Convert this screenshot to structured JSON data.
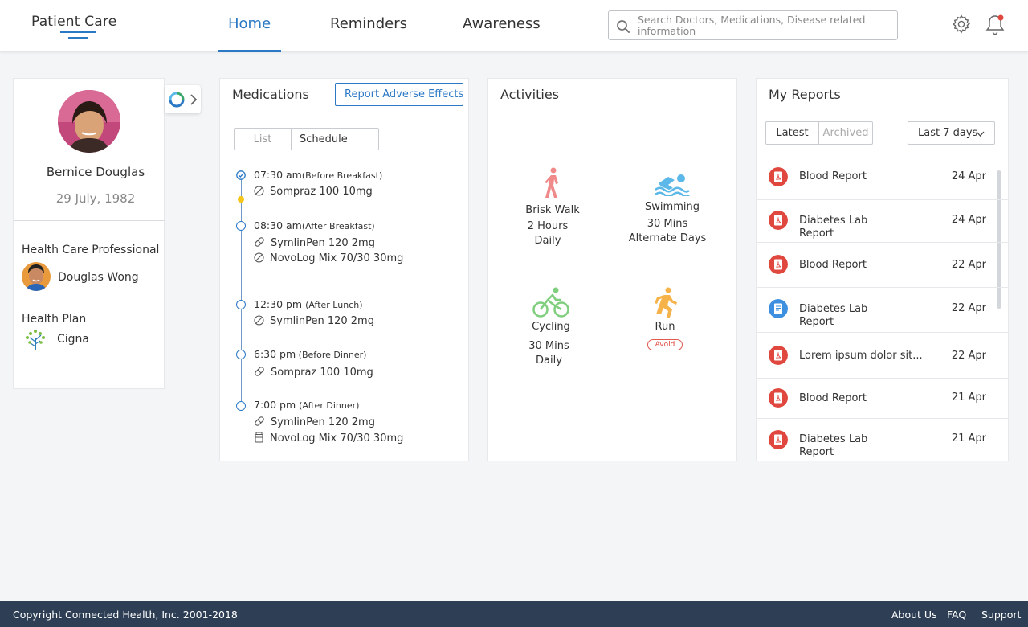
{
  "app": {
    "brand": "Patient Care"
  },
  "nav": {
    "home": "Home",
    "reminders": "Reminders",
    "awareness": "Awareness"
  },
  "search": {
    "placeholder": "Search Doctors, Medications, Disease related information"
  },
  "profile": {
    "name": "Bernice Douglas",
    "dob": "29 July, 1982",
    "hcp_label": "Health Care Professional",
    "hcp_name": "Douglas Wong",
    "plan_label": "Health Plan",
    "plan_name": "Cigna"
  },
  "medications": {
    "title": "Medications",
    "report_button": "Report Adverse Effects",
    "tabs": {
      "list": "List",
      "schedule": "Schedule"
    },
    "schedule": [
      {
        "time": "07:30 am",
        "note": "(Before Breakfast)",
        "meds": [
          {
            "icon": "tablet-icon",
            "name": "Sompraz 100 10mg"
          }
        ]
      },
      {
        "time": "08:30 am",
        "note": "(After Breakfast)",
        "meds": [
          {
            "icon": "pill-capsule-icon",
            "name": "SymlinPen 120 2mg"
          },
          {
            "icon": "tablet-icon",
            "name": "NovoLog Mix 70/30 30mg"
          }
        ]
      },
      {
        "time": "12:30 pm",
        "note": "(After Lunch)",
        "meds": [
          {
            "icon": "tablet-icon",
            "name": "SymlinPen 120 2mg"
          }
        ]
      },
      {
        "time": "6:30 pm",
        "note": " (Before Dinner)",
        "meds": [
          {
            "icon": "pill-capsule-icon",
            "name": "Sompraz 100 10mg"
          }
        ]
      },
      {
        "time": "7:00 pm",
        "note": "(After Dinner)",
        "meds": [
          {
            "icon": "pill-capsule-icon",
            "name": "SymlinPen 120 2mg"
          },
          {
            "icon": "medicine-bottle-icon",
            "name": "NovoLog Mix 70/30 30mg"
          }
        ]
      }
    ]
  },
  "activities": {
    "title": "Activities",
    "items": [
      {
        "icon": "walking-icon",
        "name": "Brisk Walk",
        "detail1": "2 Hours",
        "detail2": "Daily",
        "color": "#f08a8a"
      },
      {
        "icon": "swimming-icon",
        "name": "Swimming",
        "detail1": "30 Mins",
        "detail2": "Alternate Days",
        "color": "#5bb8e8"
      },
      {
        "icon": "cycling-icon",
        "name": "Cycling",
        "detail1": "30 Mins",
        "detail2": "Daily",
        "color": "#7fcf7f"
      },
      {
        "icon": "running-icon",
        "name": "Run",
        "badge": "Avoid",
        "color": "#f5b34a"
      }
    ]
  },
  "reports": {
    "title": "My Reports",
    "tabs": {
      "latest": "Latest",
      "archived": "Archived"
    },
    "range": "Last 7 days",
    "items": [
      {
        "type": "pdf",
        "title": "Blood Report",
        "date": "24 Apr"
      },
      {
        "type": "pdf",
        "title": "Diabetes Lab Report",
        "date": "24 Apr"
      },
      {
        "type": "pdf",
        "title": "Blood Report",
        "date": "22 Apr"
      },
      {
        "type": "doc",
        "title": "Diabetes Lab Report",
        "date": "22 Apr"
      },
      {
        "type": "pdf",
        "title": "Lorem ipsum dolor sit...",
        "date": "22 Apr"
      },
      {
        "type": "pdf",
        "title": "Blood Report",
        "date": "21 Apr"
      },
      {
        "type": "pdf",
        "title": "Diabetes Lab Report",
        "date": "21 Apr"
      }
    ]
  },
  "footer": {
    "copyright": "Copyright Connected Health, Inc. 2001-2018",
    "about": "About Us",
    "faq": "FAQ",
    "support": "Support"
  },
  "colors": {
    "primary": "#2b78c5",
    "footer": "#2e3f55",
    "pdf": "#e0473e",
    "doc": "#3d8fe0",
    "now_marker": "#f5c518"
  }
}
